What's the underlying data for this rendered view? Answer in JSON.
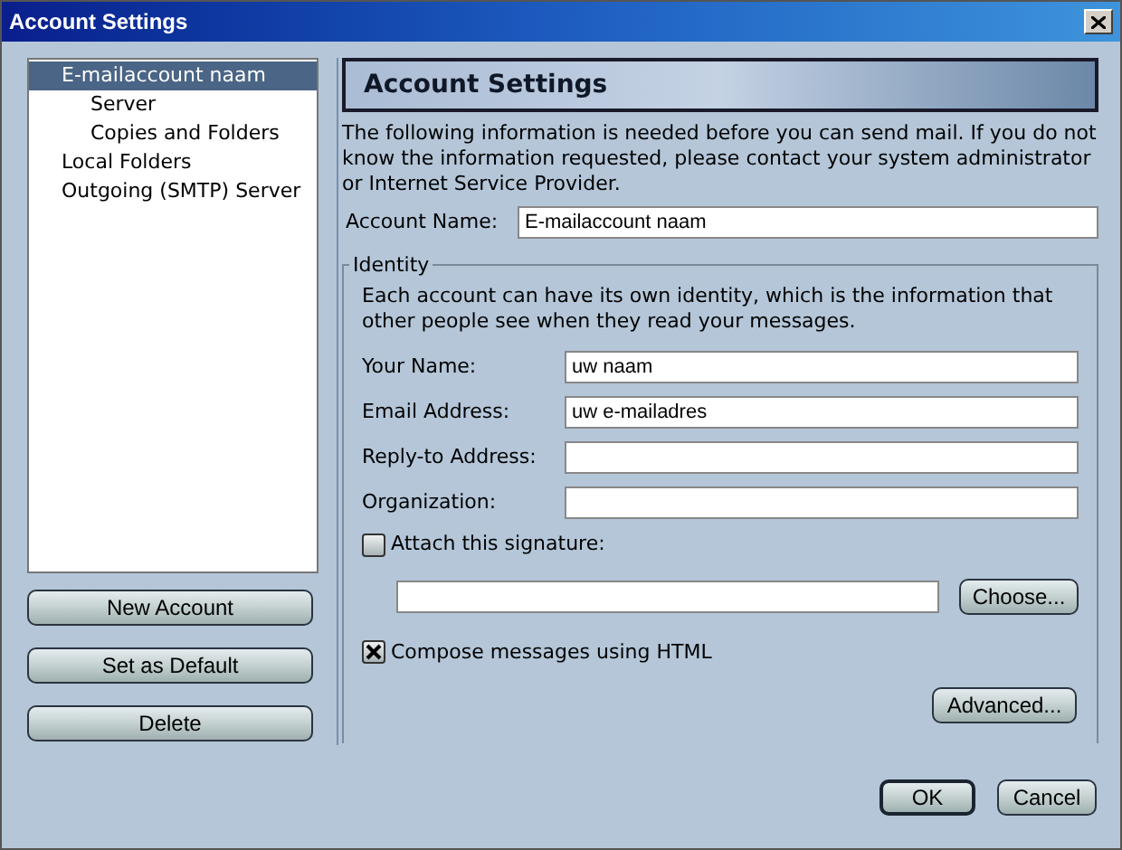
{
  "window": {
    "title": "Account Settings"
  },
  "tree": [
    {
      "label": "E-mailaccount naam",
      "selected": true,
      "children": [
        {
          "label": "Server",
          "selected": false
        },
        {
          "label": "Copies and Folders",
          "selected": false
        }
      ]
    },
    {
      "label": "Local Folders",
      "selected": false
    },
    {
      "label": "Outgoing (SMTP) Server",
      "selected": false
    }
  ],
  "side_buttons": [
    "New Account",
    "Set as Default",
    "Delete"
  ],
  "panel": {
    "header": "Account Settings",
    "intro": "The following information is needed before you can send mail. If you do not know the information requested, please contact your system administrator or Internet Service Provider.",
    "account_name": {
      "label": "Account Name:",
      "value": "E-mailaccount naam"
    }
  },
  "identity": {
    "legend": "Identity",
    "description": "Each account can have its own identity, which is the information that other people see when they read your messages.",
    "fields": [
      {
        "label": "Your Name:",
        "value": "uw naam"
      },
      {
        "label": "Email Address:",
        "value": "uw e-mailadres"
      },
      {
        "label": "Reply-to Address:"
      },
      {
        "label": "Organization:"
      }
    ],
    "signature": {
      "label": "Attach this signature:",
      "checked": false,
      "button": "Choose..."
    },
    "html": {
      "label": "Compose messages using HTML",
      "checked": true
    },
    "advanced": "Advanced..."
  },
  "buttons": [
    {
      "label": "OK",
      "default": true
    },
    {
      "label": "Cancel",
      "default": false
    }
  ]
}
